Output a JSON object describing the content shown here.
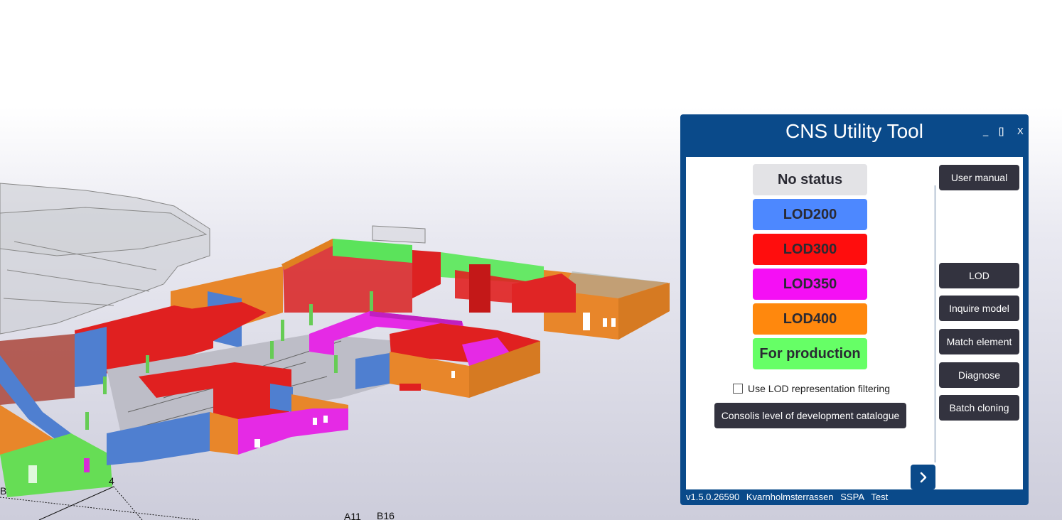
{
  "window": {
    "title": "CNS Utility Tool",
    "minimize": "_",
    "maximize": "[]",
    "close": "X"
  },
  "lod_buttons": [
    {
      "label": "No status",
      "color": "#e3e3e6"
    },
    {
      "label": "LOD200",
      "color": "#4d88ff"
    },
    {
      "label": "LOD300",
      "color": "#ff0d0d"
    },
    {
      "label": "LOD350",
      "color": "#f50ff5"
    },
    {
      "label": "LOD400",
      "color": "#ff880d"
    },
    {
      "label": "For production",
      "color": "#66ff66"
    }
  ],
  "filter": {
    "label": "Use LOD representation filtering",
    "checked": false
  },
  "catalogue_button": "Consolis level of development catalogue",
  "side_menu": {
    "user_manual": "User manual",
    "lod": "LOD",
    "inquire_model": "Inquire model",
    "match_element": "Match element",
    "diagnose": "Diagnose",
    "batch_cloning": "Batch cloning"
  },
  "next_icon": "chevron-right-icon",
  "status_bar": {
    "version": "v1.5.0.26590",
    "project": "Kvarnholmsterrassen",
    "org": "SSPA",
    "env": "Test"
  },
  "grid_labels": {
    "b_left": "B",
    "four": "4",
    "a11": "A11",
    "b16": "B16"
  },
  "colors": {
    "accent": "#0a4a8a",
    "dark_button": "#33333f"
  }
}
